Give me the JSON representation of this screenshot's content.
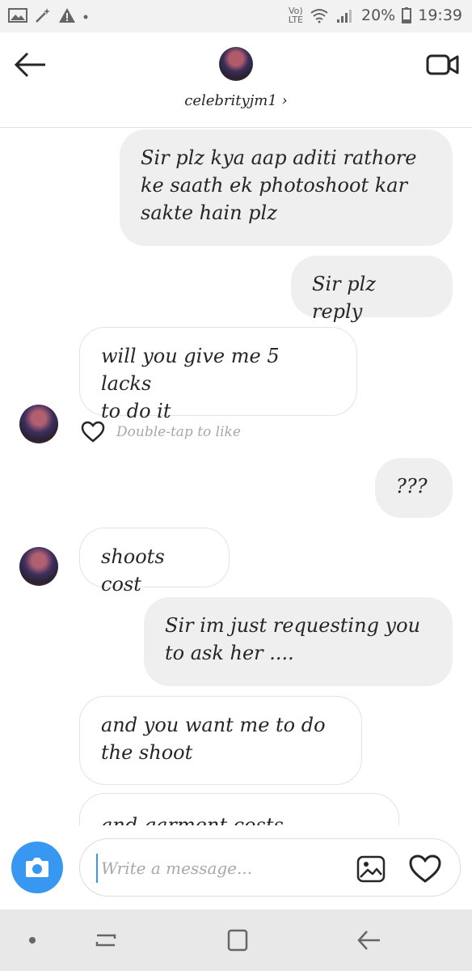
{
  "status_bar": {
    "volte_top": "Vo)",
    "volte_bottom": "LTE",
    "battery_percent": "20%",
    "time": "19:39",
    "icons": [
      "gallery-icon",
      "magic-wand-icon",
      "warning-icon",
      "dot-icon",
      "wifi-icon",
      "signal-icon",
      "battery-icon"
    ]
  },
  "header": {
    "username": "celebrityjm1 ›",
    "icons": [
      "back-arrow-icon",
      "video-call-icon"
    ]
  },
  "messages": [
    {
      "side": "outgoing",
      "text": [
        "Sir plz kya aap aditi rathore",
        "ke saath ek photoshoot kar",
        "sakte hain plz"
      ]
    },
    {
      "side": "outgoing",
      "text": [
        "Sir plz reply"
      ]
    },
    {
      "side": "incoming",
      "text": [
        "will you give me 5 lacks",
        "to do it"
      ]
    },
    {
      "side": "outgoing",
      "text": [
        "???"
      ]
    },
    {
      "side": "incoming",
      "text": [
        "shoots cost"
      ]
    },
    {
      "side": "outgoing",
      "text": [
        "Sir im just requesting you",
        "to ask her ...."
      ]
    },
    {
      "side": "incoming",
      "text": [
        "and you want me to do",
        "the shoot"
      ]
    },
    {
      "side": "incoming",
      "text": [
        "and garment costs"
      ]
    }
  ],
  "like_hint": "Double-tap to like",
  "composer": {
    "placeholder": "Write a message...",
    "icons": [
      "camera-icon",
      "gallery-icon",
      "heart-icon"
    ],
    "accent_color": "#3897f0"
  },
  "nav_bar": {
    "icons": [
      "dot-icon",
      "recents-icon",
      "home-icon",
      "back-icon"
    ]
  }
}
